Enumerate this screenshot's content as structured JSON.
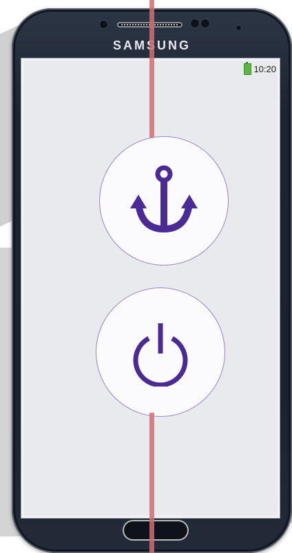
{
  "device": {
    "brand": "SAMSUNG"
  },
  "status_bar": {
    "time": "10:20",
    "battery_icon": "battery-icon",
    "battery_color": "#5eb543"
  },
  "main": {
    "anchor_button": {
      "icon": "anchor-icon",
      "icon_color": "#4a2a94"
    },
    "power_button": {
      "icon": "power-icon",
      "icon_color": "#4a2a94"
    }
  },
  "colors": {
    "screen_background": "#e9eaee",
    "button_border": "#9a82c4",
    "overlay_line": "#d86b6f"
  }
}
